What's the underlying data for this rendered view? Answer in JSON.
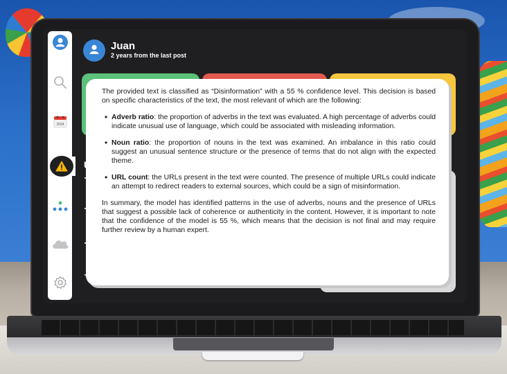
{
  "header": {
    "user_name": "Juan",
    "subtitle": "2 years from the last post"
  },
  "sidebar": {
    "items": [
      {
        "icon": "user-icon"
      },
      {
        "icon": "search-icon"
      },
      {
        "icon": "calendar-icon",
        "label": "2024"
      },
      {
        "icon": "warning-icon",
        "active": true
      },
      {
        "icon": "network-icon"
      },
      {
        "icon": "cloud-icon"
      },
      {
        "icon": "gear-icon"
      }
    ]
  },
  "background_list": {
    "heading_fragment": "U"
  },
  "cards": [
    {
      "color": "#5cc17a"
    },
    {
      "color": "#e35a4e"
    },
    {
      "color": "#f7c63f"
    }
  ],
  "modal": {
    "intro": "The provided text is classified as “Disinformation” with a 55 % confidence level. This decision is based on specific characteristics of the text, the most relevant of which are the following:",
    "features": [
      {
        "name": "Adverb ratio",
        "description": ": the proportion of adverbs in the text was evaluated. A high percentage of adverbs could indicate unusual use of language, which could be associated with misleading information."
      },
      {
        "name": "Noun ratio",
        "description": ": the proportion of nouns in the text was examined. An imbalance in this ratio could suggest an unusual sentence structure or the presence of terms that do not align with the expected theme."
      },
      {
        "name": "URL count",
        "description": ": the URLs present in the text were counted. The presence of multiple URLs could indicate an attempt to redirect readers to external sources, which could be a sign of misinformation."
      }
    ],
    "summary": "In summary, the model has identified patterns in the use of adverbs, nouns and the presence of URLs that suggest a possible lack of coherence or authenticity in the content. However, it is important to note that the confidence of the model is 55 %, which means that the decision is not final and may require further review by a human expert."
  },
  "colors": {
    "accent": "#3a86d6",
    "warning": "#f5b400",
    "screen_bg": "#1f1f21"
  }
}
